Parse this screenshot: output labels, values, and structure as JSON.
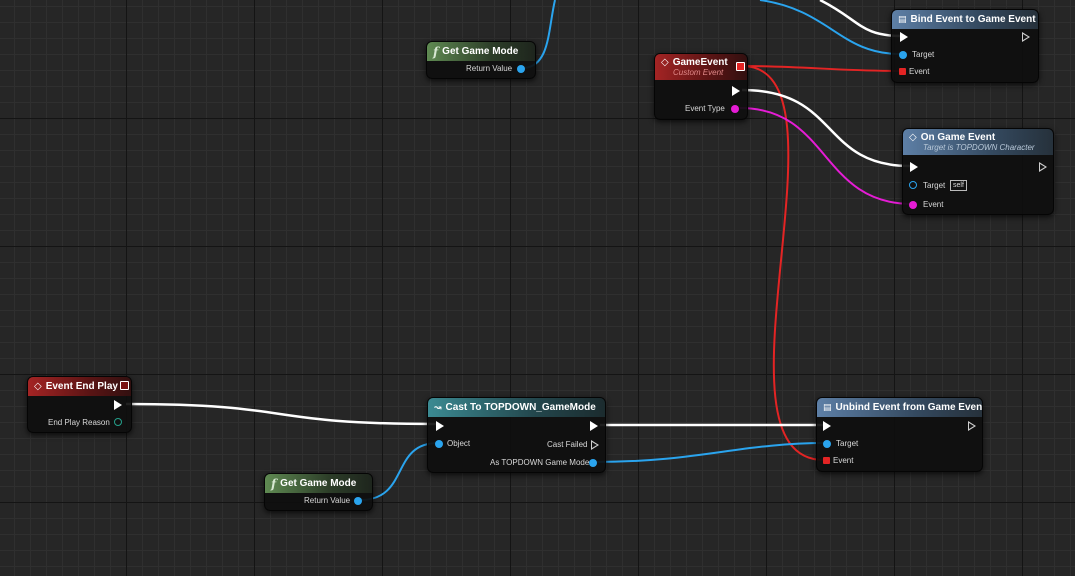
{
  "nodes": {
    "get_game_mode_top": {
      "title": "Get Game Mode",
      "return_label": "Return Value"
    },
    "bind_event": {
      "title": "Bind Event to Game Event",
      "target_label": "Target",
      "event_label": "Event"
    },
    "game_event": {
      "title": "GameEvent",
      "subtitle": "Custom Event",
      "event_type_label": "Event Type"
    },
    "on_game_event": {
      "title": "On Game Event",
      "subtitle": "Target is TOPDOWN Character",
      "target_label": "Target",
      "target_value": "self",
      "event_label": "Event"
    },
    "event_end_play": {
      "title": "Event End Play",
      "reason_label": "End Play Reason"
    },
    "cast": {
      "title": "Cast To TOPDOWN_GameMode",
      "object_label": "Object",
      "cast_failed_label": "Cast Failed",
      "as_label": "As TOPDOWN Game Mode"
    },
    "get_game_mode_bottom": {
      "title": "Get Game Mode",
      "return_label": "Return Value"
    },
    "unbind_event": {
      "title": "Unbind Event from Game Event",
      "target_label": "Target",
      "event_label": "Event"
    }
  },
  "icons": {
    "function": "function-icon",
    "event": "event-diamond-icon",
    "cast": "cast-arrows-icon",
    "bind": "bind-event-icon"
  },
  "colors": {
    "exec": "#ffffff",
    "object_pin": "#2aa4ee",
    "delegate_pin": "#e32424",
    "byte_pin": "#e51cd5",
    "enum_pin": "#25a08b"
  }
}
